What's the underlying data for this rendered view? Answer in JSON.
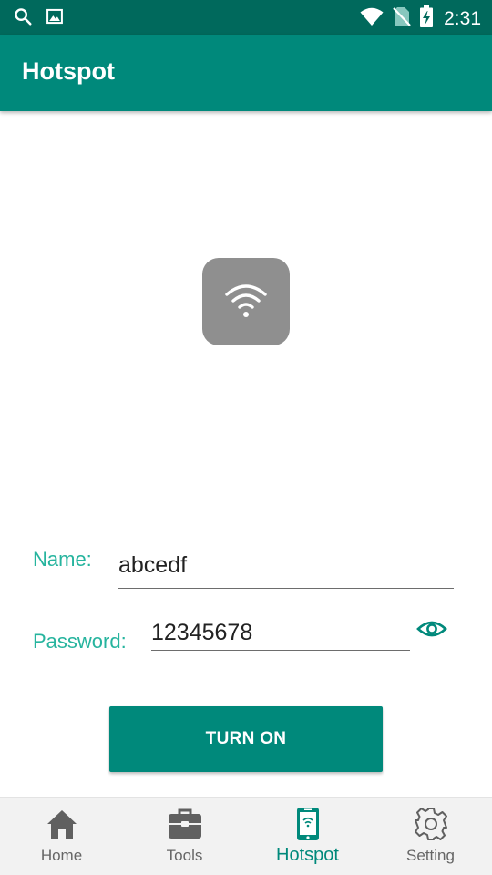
{
  "status_bar": {
    "time": "2:31",
    "left_icons": [
      "search-icon",
      "image-icon"
    ],
    "right_icons": [
      "wifi-signal-icon",
      "no-sim-icon",
      "battery-charging-icon"
    ]
  },
  "app_bar": {
    "title": "Hotspot"
  },
  "hotspot": {
    "icon": "wifi-icon"
  },
  "form": {
    "name_label": "Name:",
    "name_value": "abcedf",
    "password_label": "Password:",
    "password_value": "12345678",
    "visibility_icon": "eye-icon"
  },
  "button": {
    "label": "TURN ON"
  },
  "bottom_nav": {
    "active": "Hotspot",
    "items": [
      {
        "label": "Home",
        "icon": "home-icon"
      },
      {
        "label": "Tools",
        "icon": "toolbox-icon"
      },
      {
        "label": "Hotspot",
        "icon": "phone-hotspot-icon"
      },
      {
        "label": "Setting",
        "icon": "gear-icon"
      }
    ]
  },
  "colors": {
    "status_bar": "#00695c",
    "primary": "#00897b",
    "accent_label": "#26b49e",
    "tile": "#8f8f8f",
    "nav_background": "#f2f2f2"
  }
}
